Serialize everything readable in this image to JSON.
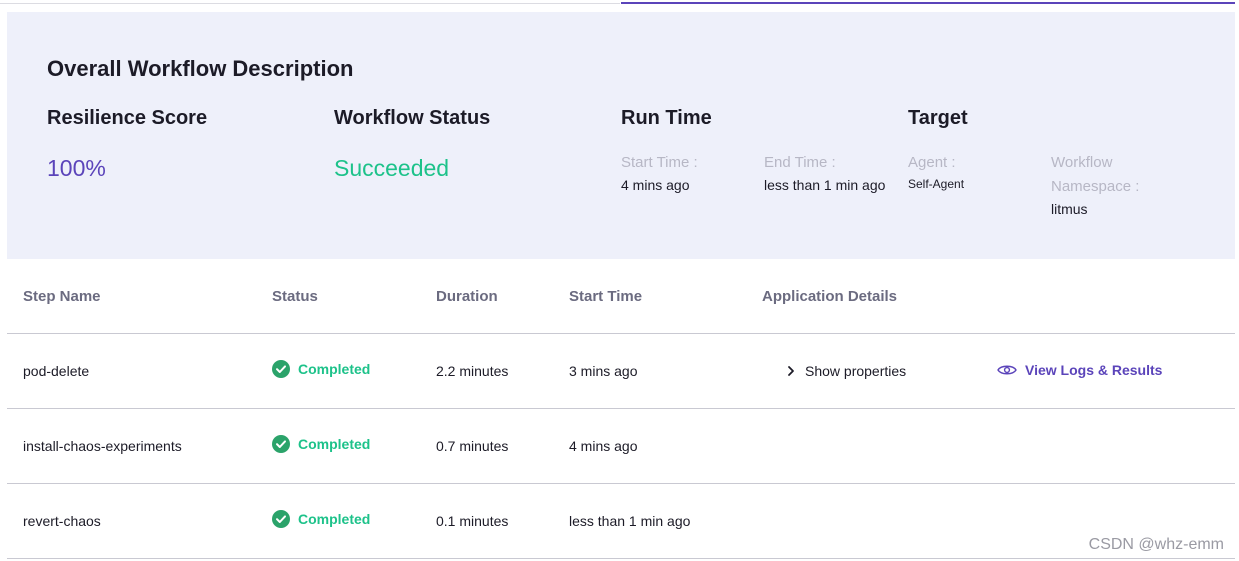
{
  "summary": {
    "title": "Overall Workflow Description",
    "resilience": {
      "label": "Resilience Score",
      "value": "100%"
    },
    "status": {
      "label": "Workflow Status",
      "value": "Succeeded"
    },
    "runtime": {
      "label": "Run Time",
      "start_label": "Start Time :",
      "start_value": "4 mins ago",
      "end_label": "End Time :",
      "end_value": "less than 1 min ago"
    },
    "target": {
      "label": "Target",
      "agent_label": "Agent :",
      "agent_value": "Self-Agent",
      "ns_label_1": "Workflow",
      "ns_label_2": "Namespace :",
      "ns_value": "litmus"
    }
  },
  "table": {
    "headers": [
      "Step Name",
      "Status",
      "Duration",
      "Start Time",
      "Application Details"
    ],
    "rows": [
      {
        "name": "pod-delete",
        "status": "Completed",
        "duration": "2.2 minutes",
        "start": "3 mins ago",
        "details": "Show properties",
        "logs": "View Logs & Results"
      },
      {
        "name": "install-chaos-experiments",
        "status": "Completed",
        "duration": "0.7 minutes",
        "start": "4 mins ago"
      },
      {
        "name": "revert-chaos",
        "status": "Completed",
        "duration": "0.1 minutes",
        "start": "less than 1 min ago"
      }
    ]
  },
  "icons": {
    "status": "check-circle-icon",
    "details": "chevron-right-icon",
    "logs": "eye-icon"
  },
  "colors": {
    "accent": "#5b44ba",
    "success": "#1dc28a",
    "check": "#2ba36a",
    "summary_bg": "#eef0fa"
  },
  "watermark": "CSDN @whz-emm"
}
